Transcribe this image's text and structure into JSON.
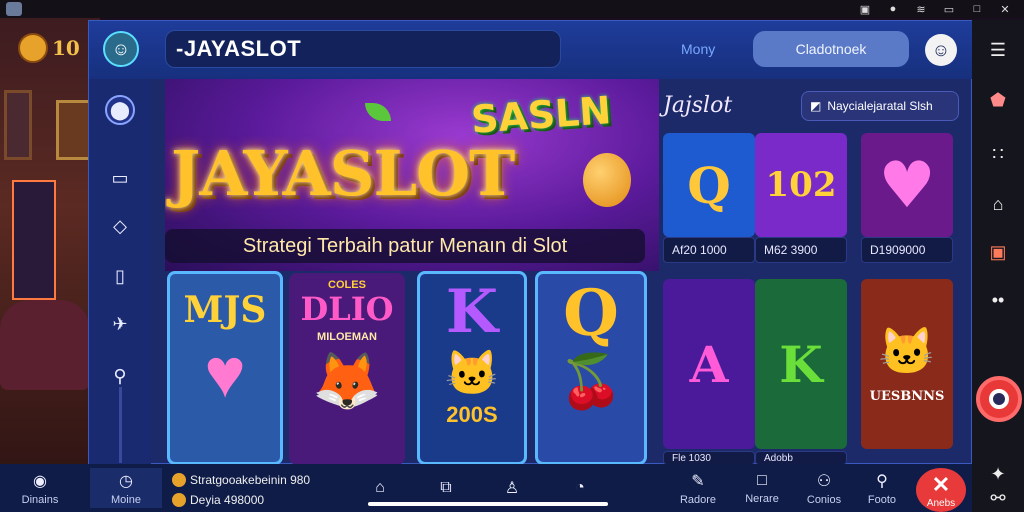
{
  "status_bar": {
    "icons": [
      "sim-icon",
      "notification-icon",
      "wifi-icon",
      "battery-icon",
      "window-icon",
      "maximize-icon",
      "close-icon"
    ]
  },
  "app_logo": {
    "text": "10"
  },
  "header": {
    "search_value": "-JAYASLOT",
    "menu_link": "Mony",
    "login_button": "Cladotnoek",
    "profile_icon": "smile-icon"
  },
  "rail": {
    "items": [
      {
        "icon": "location-icon",
        "glyph": "⬤"
      },
      {
        "icon": "card-icon",
        "glyph": "▭"
      },
      {
        "icon": "diamond-icon",
        "glyph": "◇"
      },
      {
        "icon": "door-icon",
        "glyph": "▯"
      },
      {
        "icon": "bird-icon",
        "glyph": "✈"
      },
      {
        "icon": "search-icon",
        "glyph": "⚲"
      }
    ]
  },
  "hero": {
    "badge": "SASLN",
    "title": "JAYASLOT",
    "subtitle": "Strategi Terbaih patur Menaın di Slot"
  },
  "featured_cards": [
    {
      "glyph": "MJS",
      "label": "",
      "bg": "#2a5aa8",
      "color": "#ffd23a",
      "accent": "♥",
      "accent_color": "#ff7ad0"
    },
    {
      "glyph": "DLIO",
      "label": "MILOEMAN",
      "bg": "#4a1a7a",
      "color": "#ff5ac8",
      "accent": "🦊",
      "accent_color": "#e0903a",
      "top": "COLES"
    },
    {
      "glyph": "K",
      "label": "200S",
      "bg": "#1a3a8a",
      "color": "#b45aff",
      "accent": "🐱",
      "accent_color": "#3ac8ff"
    },
    {
      "glyph": "Q",
      "label": "",
      "bg": "#2a4aa8",
      "color": "#ffc22a",
      "accent": "🍒",
      "accent_color": "#e83a3a"
    }
  ],
  "grid": {
    "title": "Jajslot",
    "filter_label": "Naycialejaratal Slsh",
    "tiles": [
      {
        "glyph": "Q",
        "bg": "#1e5ad0",
        "color": "#ffc83a",
        "caption": "Af20 1000"
      },
      {
        "glyph": "102",
        "bg": "#7a2ac8",
        "color": "#ffd23a",
        "caption": "M62 3900"
      },
      {
        "glyph": "♥",
        "bg": "#6a1a8a",
        "color": "#ff7ae8",
        "caption": "D1909000"
      },
      {
        "glyph": "A",
        "bg": "#4a1a9a",
        "color": "#ff5ad8",
        "caption": "Fle 1030"
      },
      {
        "glyph": "K",
        "bg": "#1a6a3a",
        "color": "#6adf3a",
        "caption": "Adobb"
      },
      {
        "glyph": "🐱",
        "bg": "#8a2a1a",
        "color": "#ffc23a",
        "caption": "UESBNNS"
      }
    ]
  },
  "right_nav": [
    {
      "icon": "menu-icon",
      "glyph": "☰"
    },
    {
      "icon": "gem-icon",
      "glyph": "⬟"
    },
    {
      "icon": "grid-icon",
      "glyph": "∷"
    },
    {
      "icon": "home-icon",
      "glyph": "⌂"
    },
    {
      "icon": "gift-icon",
      "glyph": "▣"
    },
    {
      "icon": "more-icon",
      "glyph": "••"
    },
    {
      "icon": "record-icon",
      "glyph": ""
    },
    {
      "icon": "sparkle-icon",
      "glyph": "✦"
    },
    {
      "icon": "share-icon",
      "glyph": "⚯"
    }
  ],
  "bottom_nav": {
    "left_label": "Dinains",
    "active_label": "Moine",
    "promo": [
      "Stratgooakebeinin 980",
      "Deyia 498000"
    ],
    "mid_icons": [
      "tag-icon",
      "tablet-icon",
      "user-icon",
      "clock-icon"
    ],
    "items": [
      "Radore",
      "Nerare",
      "Conios",
      "Footo"
    ],
    "close_label": "Anebs"
  }
}
